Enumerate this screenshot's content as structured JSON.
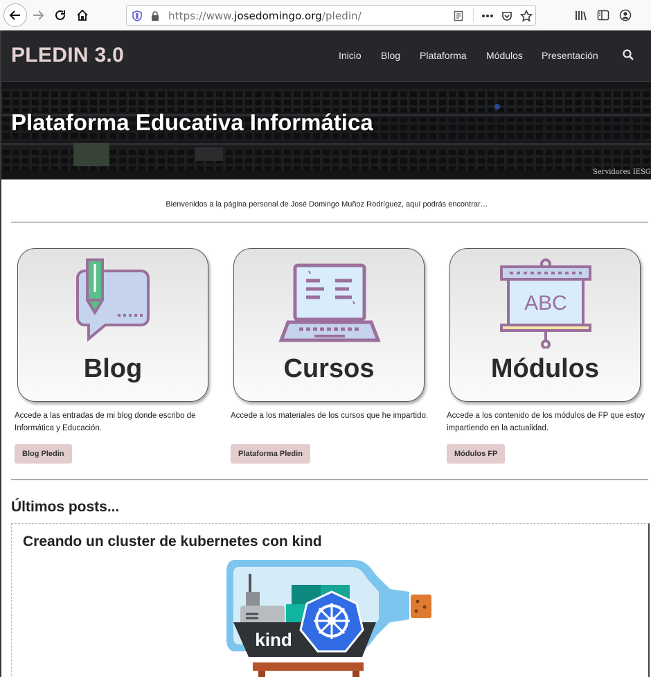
{
  "browser": {
    "url_prefix": "https://www.",
    "url_domain": "josedomingo.org",
    "url_path": "/pledin/"
  },
  "site": {
    "brand": "PLEDIN 3.0",
    "nav": [
      "Inicio",
      "Blog",
      "Plataforma",
      "Módulos",
      "Presentación"
    ]
  },
  "hero": {
    "title": "Plataforma Educativa Informática",
    "credit": "Servidores IESGN"
  },
  "welcome": "Bienvenidos a la página personal de José Domingo Muñoz Rodríguez, aquí podrás encontrar…",
  "cards": [
    {
      "title": "Blog",
      "icon": "chat-pencil-icon",
      "description": "Accede a las entradas de mi blog donde escribo de Informática y Educación.",
      "button": "Blog Pledin"
    },
    {
      "title": "Cursos",
      "icon": "laptop-icon",
      "description": "Accede a los materiales de los cursos que he impartido.",
      "button": "Plataforma Pledin"
    },
    {
      "title": "Módulos",
      "icon": "presentation-board-icon",
      "description": "Accede a los contenido de los módulos de FP que estoy impartiendo en la actualidad.",
      "button": "Módulos FP"
    }
  ],
  "illus_colors": {
    "outline": "#9b6f9c",
    "fill": "#c5d3ec",
    "accent": "#5bbf8a",
    "pale": "#d8ecfb"
  },
  "posts": {
    "heading": "Últimos posts...",
    "items": [
      {
        "title": "Creando un cluster de kubernetes con kind",
        "image_label": "kind"
      }
    ]
  },
  "colors": {
    "navbar": "#25272a",
    "brand": "#e6d2d2",
    "button": "#e3cccd",
    "k8s_blue": "#326ce5",
    "bottle": "#7cc5ee"
  }
}
